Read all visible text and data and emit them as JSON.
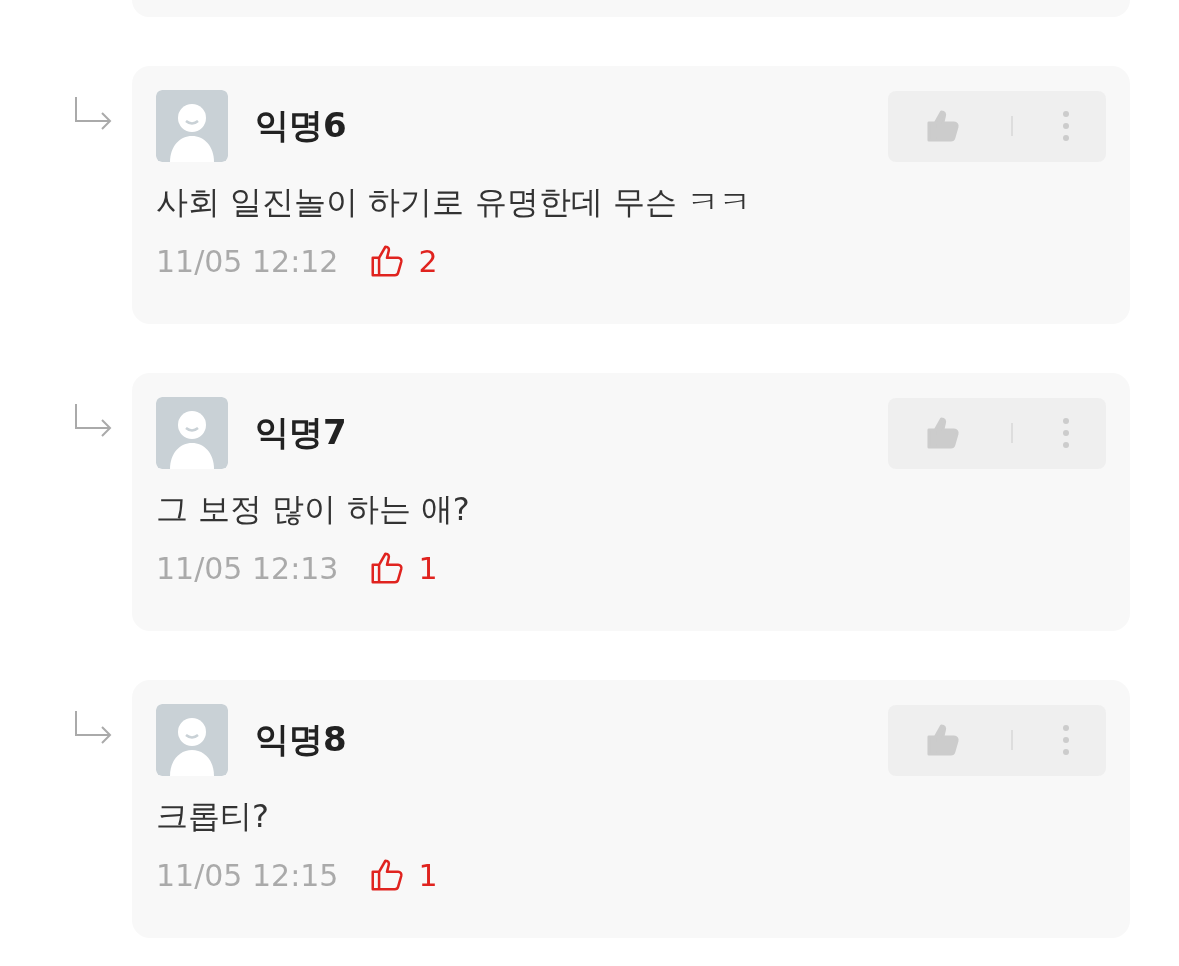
{
  "comments": [
    {
      "author": "익명6",
      "text": "사회 일진놀이 하기로 유명한데 무슨 ㅋㅋ",
      "time": "11/05 12:12",
      "likes": "2"
    },
    {
      "author": "익명7",
      "text": "그 보정 많이 하는 애?",
      "time": "11/05 12:13",
      "likes": "1"
    },
    {
      "author": "익명8",
      "text": "크롭티?",
      "time": "11/05 12:15",
      "likes": "1"
    }
  ]
}
